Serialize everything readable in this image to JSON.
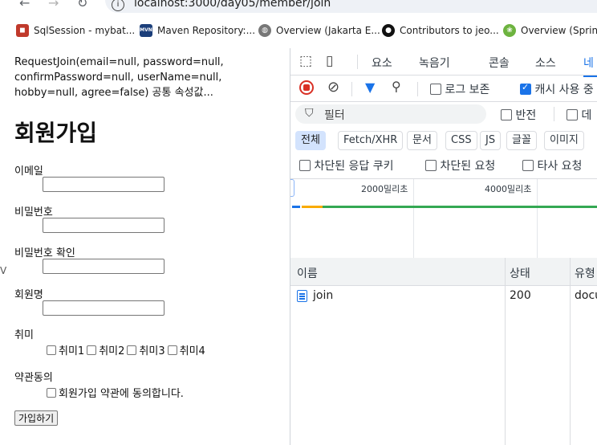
{
  "browser": {
    "url": "localhost:3000/day05/member/join",
    "bookmarks": [
      {
        "label": "SqlSession - mybat...",
        "icon": "sqlsession-bookmark-icon"
      },
      {
        "label": "Maven Repository:...",
        "icon": "maven-bookmark-icon"
      },
      {
        "label": "Overview (Jakarta E...",
        "icon": "globe-bookmark-icon"
      },
      {
        "label": "Contributors to jeo...",
        "icon": "github-bookmark-icon"
      },
      {
        "label": "Overview (Spring",
        "icon": "spring-bookmark-icon"
      }
    ]
  },
  "page": {
    "request_text": "RequestJoin(email=null, password=null, confirmPassword=null, userName=null, hobby=null, agree=false) 공통 속성값...",
    "title": "회원가입",
    "fields": [
      {
        "label": "이메일",
        "value": ""
      },
      {
        "label": "비밀번호",
        "value": ""
      },
      {
        "label": "비밀번호 확인",
        "value": ""
      },
      {
        "label": "회원명",
        "value": ""
      }
    ],
    "hobby_label": "취미",
    "hobbies": [
      "취미1",
      "취미2",
      "취미3",
      "취미4"
    ],
    "agree_label": "약관동의",
    "agree_text": "회원가입 약관에 동의합니다.",
    "submit_label": "가입하기",
    "edge_char": "V"
  },
  "devtools": {
    "tabs": [
      "요소",
      "녹음기",
      "콘솔",
      "소스",
      "네"
    ],
    "active_tab": "네",
    "preserve_log": "로그 보존",
    "disable_cache": "캐시 사용 중",
    "filter_placeholder": "필터",
    "invert": "반전",
    "data_url": "데",
    "chips": [
      "전체",
      "Fetch/XHR",
      "문서",
      "CSS",
      "JS",
      "글꼴",
      "이미지"
    ],
    "blocked_cookies": "차단된 응답 쿠키",
    "blocked_requests": "차단된 요청",
    "third_party": "타사 요청",
    "timeline_labels": [
      "2000밀리초",
      "4000밀리초"
    ],
    "columns": [
      "이름",
      "상태",
      "유형"
    ],
    "rows": [
      {
        "name": "join",
        "status": "200",
        "type": "docu"
      }
    ],
    "colors": {
      "accent": "#1a73e8",
      "record": "#d93025",
      "bar_green": "#34a853",
      "bar_yellow": "#f9ab00"
    }
  }
}
